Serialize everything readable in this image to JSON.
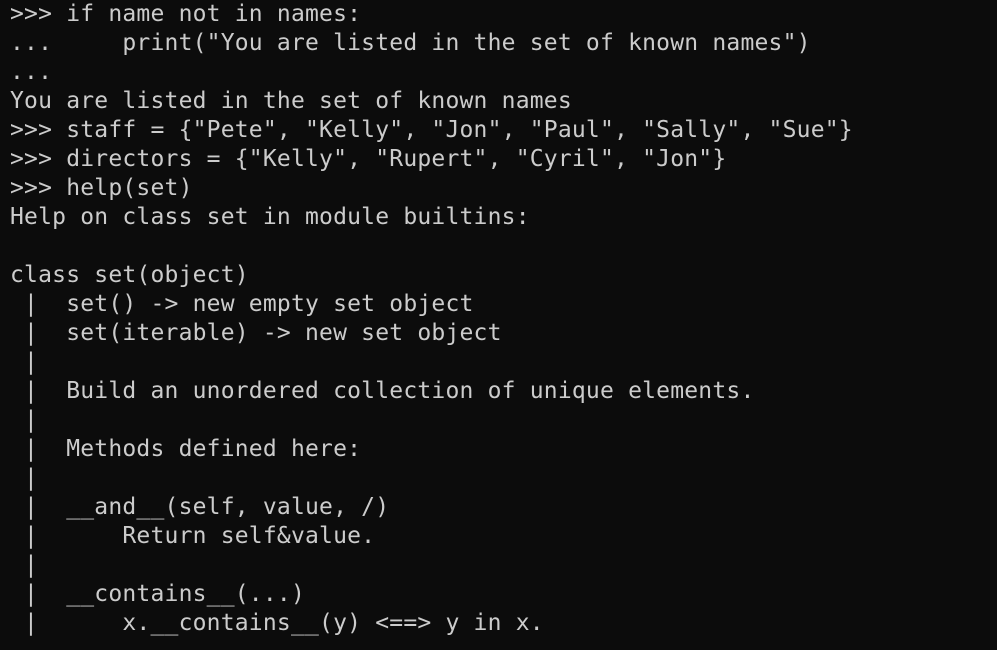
{
  "terminal": {
    "lines": [
      ">>> if name not in names:",
      "...     print(\"You are listed in the set of known names\")",
      "...",
      "You are listed in the set of known names",
      ">>> staff = {\"Pete\", \"Kelly\", \"Jon\", \"Paul\", \"Sally\", \"Sue\"}",
      ">>> directors = {\"Kelly\", \"Rupert\", \"Cyril\", \"Jon\"}",
      ">>> help(set)",
      "Help on class set in module builtins:",
      "",
      "class set(object)",
      " |  set() -> new empty set object",
      " |  set(iterable) -> new set object",
      " |",
      " |  Build an unordered collection of unique elements.",
      " |",
      " |  Methods defined here:",
      " |",
      " |  __and__(self, value, /)",
      " |      Return self&value.",
      " |",
      " |  __contains__(...)",
      " |      x.__contains__(y) <==> y in x."
    ]
  },
  "colors": {
    "background": "#0c0c0c",
    "foreground": "#cccccc"
  }
}
